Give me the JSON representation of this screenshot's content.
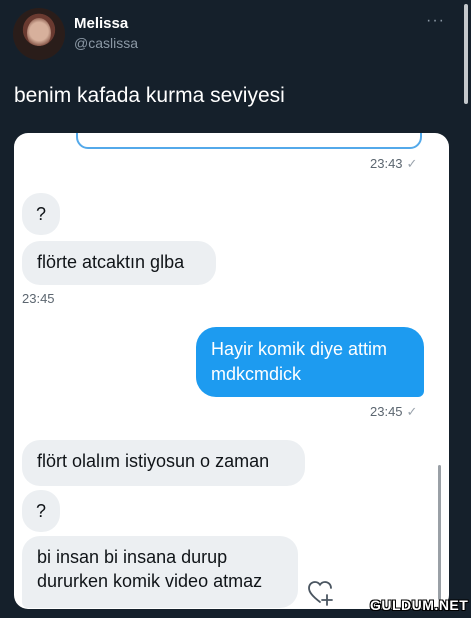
{
  "tweet": {
    "author_name": "Melissa",
    "author_handle": "@caslissa",
    "more_icon": "more-icon",
    "text": "benim kafada kurma seviyesi"
  },
  "chat": {
    "top_time": "23:43",
    "messages": [
      {
        "side": "in",
        "text": "?"
      },
      {
        "side": "in",
        "text": "flörte atcaktın glba"
      },
      {
        "side": "in_time",
        "text": "23:45"
      },
      {
        "side": "out",
        "text": "Hayir komik diye attim mdkcmdick"
      },
      {
        "side": "out_time",
        "text": "23:45"
      },
      {
        "side": "in",
        "text": "flört olalım istiyosun o zaman"
      },
      {
        "side": "in",
        "text": "?"
      },
      {
        "side": "in",
        "text": "bi insan bi insana durup dururken komik video atmaz"
      }
    ],
    "read_tick": "✓",
    "reaction_icon": "heart-add-icon"
  },
  "watermark": "GULDUM.NET",
  "colors": {
    "background": "#15202b",
    "outgoing_bubble": "#1d9bf0",
    "incoming_bubble": "#eceff2"
  }
}
